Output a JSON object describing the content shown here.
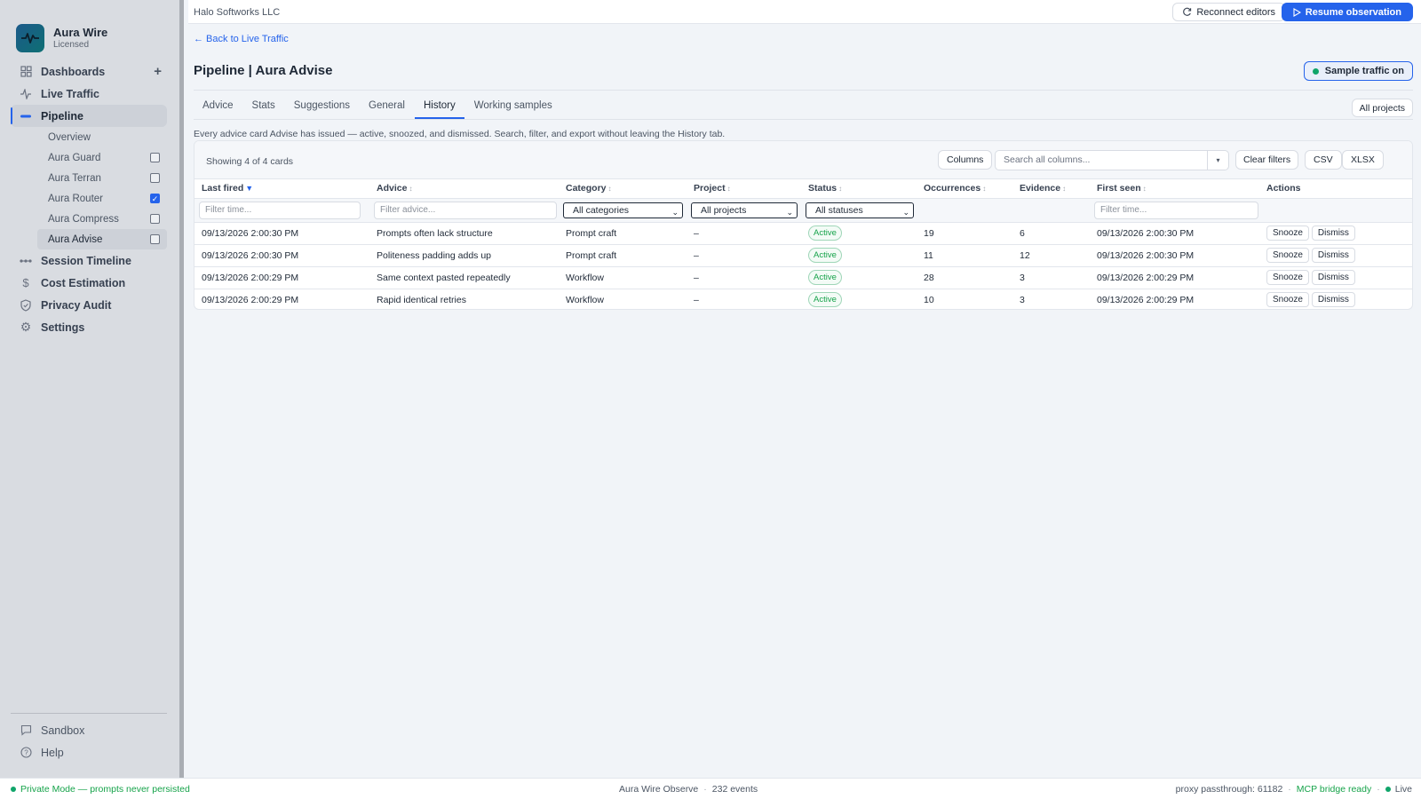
{
  "app": {
    "name": "Aura Wire",
    "license": "Licensed"
  },
  "sidebar": {
    "nav": [
      {
        "label": "Dashboards",
        "icon": "grid-icon"
      },
      {
        "label": "Live Traffic",
        "icon": "activity-icon"
      },
      {
        "label": "Pipeline",
        "icon": "pipeline-icon"
      }
    ],
    "pipeline_sub": [
      {
        "label": "Overview"
      },
      {
        "label": "Aura Guard",
        "checked": false
      },
      {
        "label": "Aura Terran",
        "checked": false
      },
      {
        "label": "Aura Router",
        "checked": true
      },
      {
        "label": "Aura Compress",
        "checked": false
      },
      {
        "label": "Aura Advise",
        "checked": false
      }
    ],
    "nav2": [
      {
        "label": "Session Timeline",
        "icon": "timeline-icon"
      },
      {
        "label": "Cost Estimation",
        "icon": "dollar-icon"
      },
      {
        "label": "Privacy Audit",
        "icon": "shield-icon"
      },
      {
        "label": "Settings",
        "icon": "gear-icon"
      }
    ],
    "bottom": [
      {
        "label": "Sandbox",
        "icon": "chat-icon"
      },
      {
        "label": "Help",
        "icon": "help-icon"
      }
    ]
  },
  "topbar": {
    "org": "Halo Softworks LLC",
    "reconnect": "Reconnect editors",
    "resume": "Resume observation"
  },
  "page": {
    "back": "← Back to Live Traffic",
    "title": "Pipeline | Aura Advise",
    "sample_toggle": "Sample traffic on",
    "tabs": [
      "Advice",
      "Stats",
      "Suggestions",
      "General",
      "History",
      "Working samples"
    ],
    "active_tab": "History",
    "all_projects": "All projects",
    "description": "Every advice card Advise has issued — active, snoozed, and dismissed. Search, filter, and export without leaving the History tab."
  },
  "table": {
    "showing": "Showing 4 of 4 cards",
    "columns_btn": "Columns",
    "search_placeholder": "Search all columns...",
    "clear_filters": "Clear filters",
    "csv": "CSV",
    "xlsx": "XLSX",
    "headers": [
      "Last fired",
      "Advice",
      "Category",
      "Project",
      "Status",
      "Occurrences",
      "Evidence",
      "First seen",
      "Actions"
    ],
    "filters": {
      "time_placeholder": "Filter time...",
      "advice_placeholder": "Filter advice...",
      "category": "All categories",
      "project": "All projects",
      "status": "All statuses",
      "first_seen_placeholder": "Filter time..."
    },
    "rows": [
      {
        "last_fired": "09/13/2026 2:00:30 PM",
        "advice": "Prompts often lack structure",
        "category": "Prompt craft",
        "project": "–",
        "status": "Active",
        "occurrences": "19",
        "evidence": "6",
        "first_seen": "09/13/2026 2:00:30 PM"
      },
      {
        "last_fired": "09/13/2026 2:00:30 PM",
        "advice": "Politeness padding adds up",
        "category": "Prompt craft",
        "project": "–",
        "status": "Active",
        "occurrences": "11",
        "evidence": "12",
        "first_seen": "09/13/2026 2:00:30 PM"
      },
      {
        "last_fired": "09/13/2026 2:00:29 PM",
        "advice": "Same context pasted repeatedly",
        "category": "Workflow",
        "project": "–",
        "status": "Active",
        "occurrences": "28",
        "evidence": "3",
        "first_seen": "09/13/2026 2:00:29 PM"
      },
      {
        "last_fired": "09/13/2026 2:00:29 PM",
        "advice": "Rapid identical retries",
        "category": "Workflow",
        "project": "–",
        "status": "Active",
        "occurrences": "10",
        "evidence": "3",
        "first_seen": "09/13/2026 2:00:29 PM"
      }
    ],
    "actions": {
      "snooze": "Snooze",
      "dismiss": "Dismiss"
    }
  },
  "footer": {
    "private_mode": "Private Mode — prompts never persisted",
    "product": "Aura Wire Observe",
    "events": "232 events",
    "proxy": "proxy passthrough: 61182",
    "mcp": "MCP bridge ready",
    "live": "Live"
  },
  "colors": {
    "accent": "#2563eb",
    "success": "#16a34a",
    "sidebar_bg": "#d9dce1"
  }
}
